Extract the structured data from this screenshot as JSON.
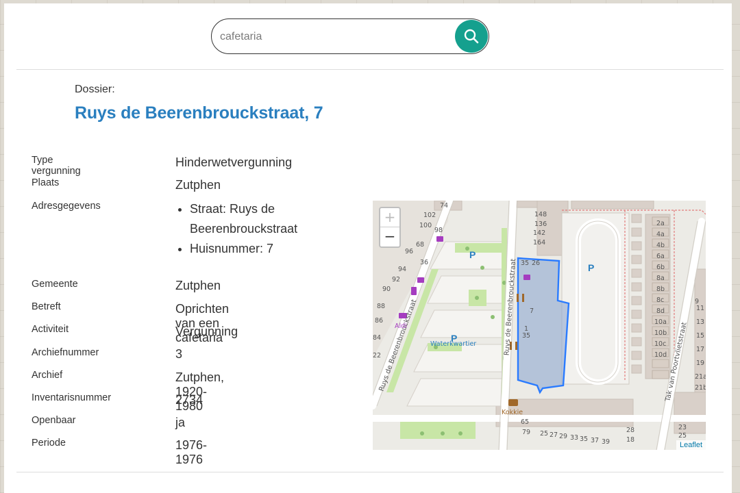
{
  "search": {
    "placeholder": "cafetaria"
  },
  "dossier": {
    "label": "Dossier:",
    "title": "Ruys de Beerenbrouckstraat, 7"
  },
  "fields": {
    "type_label": "Type vergunning",
    "type_value": "Hinderwetvergunning",
    "plaats_label": "Plaats",
    "plaats_value": "Zutphen",
    "adres_label": "Adresgegevens",
    "adres_straat": "Straat: Ruys de Beerenbrouckstraat",
    "adres_huisnummer": "Huisnummer: 7",
    "gemeente_label": "Gemeente",
    "gemeente_value": "Zutphen",
    "betreft_label": "Betreft",
    "betreft_value": "Oprichten van een cafetaria",
    "activiteit_label": "Activiteit",
    "activiteit_value": "Vergunning",
    "archiefnummer_label": "Archiefnummer",
    "archiefnummer_value": "3",
    "archief_label": "Archief",
    "archief_value": "Zutphen, 1920-1980",
    "inventaris_label": "Inventarisnummer",
    "inventaris_value": "2734",
    "openbaar_label": "Openbaar",
    "openbaar_value": "ja",
    "periode_label": "Periode",
    "periode_value": "1976-1976"
  },
  "map": {
    "zoom_in": "+",
    "zoom_out": "−",
    "attribution": "Leaflet",
    "street_1": "Ruys de Beerenbrouckstraat",
    "street_2": "Ruys de Beerenbrouckstraat",
    "street_3": "Tak van Poortvlietstraat",
    "poi_aldi": "Aldi",
    "poi_waterkwartier": "Waterkwartier",
    "poi_kokkie": "Kokkie",
    "parking": "P",
    "house_numbers": [
      "74",
      "102",
      "100",
      "98",
      "96",
      "68",
      "36",
      "94",
      "92",
      "90",
      "88",
      "86",
      "84",
      "22",
      "148",
      "136",
      "142",
      "164",
      "35",
      "26",
      "7",
      "1",
      "35",
      "2a",
      "4a",
      "4b",
      "6a",
      "6b",
      "8a",
      "8b",
      "8c",
      "8d",
      "10a",
      "10b",
      "10c",
      "10d",
      "65",
      "79",
      "25",
      "27",
      "29",
      "33",
      "35",
      "37",
      "39",
      "28",
      "18",
      "23",
      "25",
      "11",
      "13",
      "15",
      "17",
      "19",
      "21",
      "21a",
      "21b"
    ],
    "colors": {
      "highlight": "#2a7bff",
      "park": "#c8e6a6",
      "building": "#d9d0c9",
      "road": "#ffffff"
    }
  },
  "colors": {
    "accent_teal": "#15a08e",
    "title_blue": "#2a7fbf"
  }
}
